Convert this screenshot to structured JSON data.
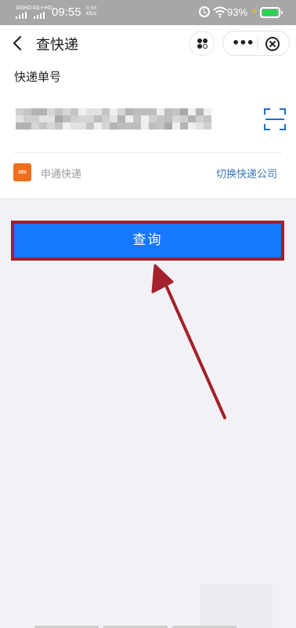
{
  "status_bar": {
    "signal1_label": "4GHD",
    "signal2_label": "4G+HD",
    "time": "09:55",
    "speed_value": "0.50",
    "speed_unit": "KB/s",
    "battery_percent": "93%"
  },
  "header": {
    "title": "查快递",
    "icons": [
      "back-icon",
      "mini-program-icon",
      "more-icon",
      "close-icon"
    ]
  },
  "form": {
    "tracking_label": "快递单号",
    "tracking_value_state": "pixelated",
    "carrier_logo_text": "sto",
    "carrier_name": "申通快递",
    "switch_carrier_link": "切换快递公司"
  },
  "query_button": {
    "label": "查询"
  },
  "colors": {
    "primary_button": "#1677ff",
    "annotation_red": "#a4202a",
    "link_blue": "#3a76b7",
    "carrier_orange": "#f06e1c",
    "battery_green": "#26d250"
  }
}
